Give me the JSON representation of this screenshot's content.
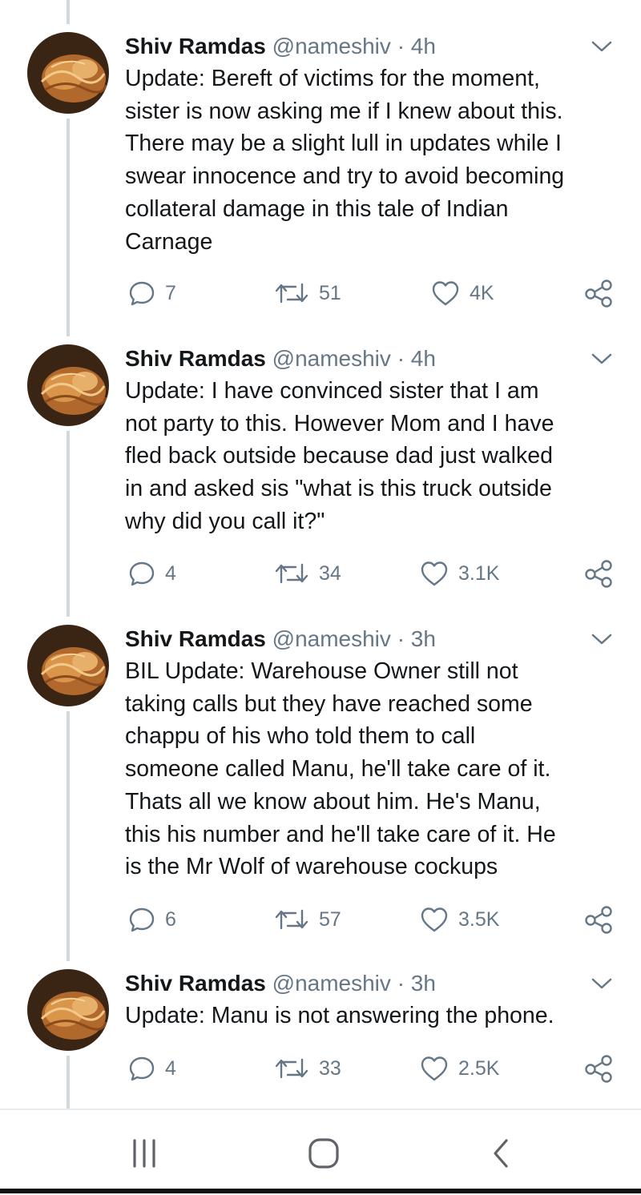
{
  "tweets": [
    {
      "name": "Shiv Ramdas",
      "handle": "@nameshiv",
      "separator": "·",
      "time": "4h",
      "lines": [
        "Update: Bereft of victims for the moment,",
        "sister is now asking me if I knew about this.",
        "There may be a slight lull in updates while I",
        "swear innocence and try to avoid becoming",
        "collateral damage in this tale of Indian",
        "Carnage"
      ],
      "replies": "7",
      "retweets": "51",
      "likes": "4K"
    },
    {
      "name": "Shiv Ramdas",
      "handle": "@nameshiv",
      "separator": "·",
      "time": "4h",
      "lines": [
        "Update: I have convinced sister that I am",
        "not party to this. However Mom and I have",
        "fled back outside because dad just walked",
        "in and asked sis \"what is this truck outside",
        "why did you call it?\""
      ],
      "replies": "4",
      "retweets": "34",
      "likes": "3.1K"
    },
    {
      "name": "Shiv Ramdas",
      "handle": "@nameshiv",
      "separator": "·",
      "time": "3h",
      "lines": [
        "BIL Update: Warehouse Owner still not",
        "taking calls but they have reached some",
        "chappu of his who told them to call",
        "someone called Manu, he'll take care of it.",
        "Thats all we know about him. He's Manu,",
        "this his number and he'll take care of it.  He",
        "is the Mr Wolf of warehouse cockups"
      ],
      "replies": "6",
      "retweets": "57",
      "likes": "3.5K"
    },
    {
      "name": "Shiv Ramdas",
      "handle": "@nameshiv",
      "separator": "·",
      "time": "3h",
      "lines": [
        "Update: Manu is not answering the phone."
      ],
      "replies": "4",
      "retweets": "33",
      "likes": "2.5K"
    }
  ],
  "icons": {
    "reply": "reply-icon",
    "retweet": "retweet-icon",
    "like": "like-icon",
    "share": "share-icon",
    "more": "chevron-down-icon",
    "nav_recents": "recent-apps-icon",
    "nav_home": "home-icon",
    "nav_back": "back-icon"
  },
  "colors": {
    "text": "#14171a",
    "secondary": "#657786",
    "thread_line": "#cfd9de"
  }
}
